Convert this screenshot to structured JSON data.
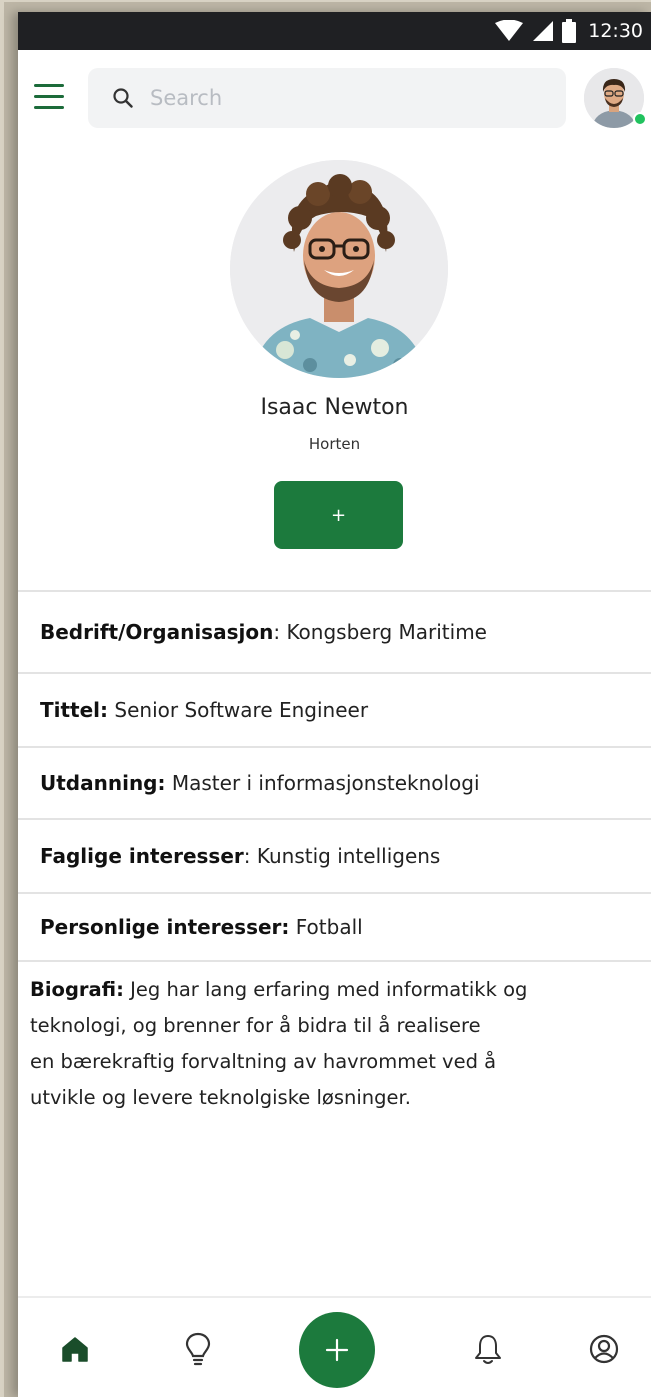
{
  "status_bar": {
    "time": "12:30",
    "icons": [
      "wifi-icon",
      "signal-icon",
      "battery-icon"
    ]
  },
  "header": {
    "menu_icon": "hamburger-menu-icon",
    "search": {
      "icon": "search-icon",
      "placeholder": "Search"
    },
    "avatar": {
      "online": true
    }
  },
  "profile": {
    "name": "Isaac Newton",
    "location": "Horten",
    "add_label": "+"
  },
  "details": [
    {
      "label": "Bedrift/Organisasjon",
      "separator": ": ",
      "value": "Kongsberg Maritime"
    },
    {
      "label": "Tittel:",
      "separator": " ",
      "value": "Senior Software Engineer"
    },
    {
      "label": "Utdanning:",
      "separator": " ",
      "value": "Master i informasjonsteknologi"
    },
    {
      "label": "Faglige interesser",
      "separator": ": ",
      "value": "Kunstig intelligens"
    },
    {
      "label": "Personlige interesser:",
      "separator": " ",
      "value": "Fotball"
    }
  ],
  "bio": {
    "label": "Biografi:",
    "lines": [
      " Jeg har lang erfaring med informatikk og",
      "teknologi, og brenner for å bidra til å realisere",
      "en bærekraftig forvaltning av havrommet ved å",
      "utvikle og levere teknolgiske løsninger."
    ]
  },
  "bottom_nav": {
    "items": [
      "home-icon",
      "lightbulb-icon",
      "add-icon",
      "bell-icon",
      "profile-icon"
    ],
    "active": "home-icon",
    "fab_label": "+"
  },
  "colors": {
    "accent": "#1c7a3d",
    "status_bar": "#1f2023",
    "online": "#21c25e"
  }
}
